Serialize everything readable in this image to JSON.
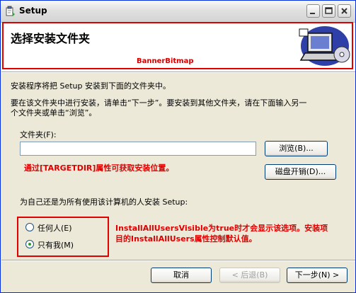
{
  "window": {
    "title": "Setup"
  },
  "banner": {
    "title": "选择安装文件夹",
    "bitmap_label": "BannerBitmap"
  },
  "body": {
    "line1": "安装程序将把 Setup 安装到下面的文件夹中。",
    "line2": "要在该文件夹中进行安装，请单击“下一步”。要安装到其他文件夹，请在下面输入另一",
    "line3": "个文件夹或单击“浏览”。",
    "folder_label": "文件夹(F):",
    "folder_value": "",
    "targetdir_note": "通过[TARGETDIR]属性可获取安装位置。",
    "browse_button": "浏览(B)...",
    "disk_cost_button": "磁盘开销(D)...",
    "users_question": "为自己还是为所有使用该计算机的人安装 Setup:",
    "radio_everyone": "任何人(E)",
    "radio_just_me": "只有我(M)",
    "radio_selected": "just_me",
    "visibility_note_line1": "InstallAllUsersVisible为true时才会显示该选项。安装项",
    "visibility_note_line2": "目的InstallAllUsers属性控制默认值。"
  },
  "footer": {
    "cancel_button": "取消",
    "back_button": "< 后退(B)",
    "next_button": "下一步(N) >"
  },
  "colors": {
    "annotation_red": "#E00000",
    "window_bg": "#ECE9D8"
  }
}
